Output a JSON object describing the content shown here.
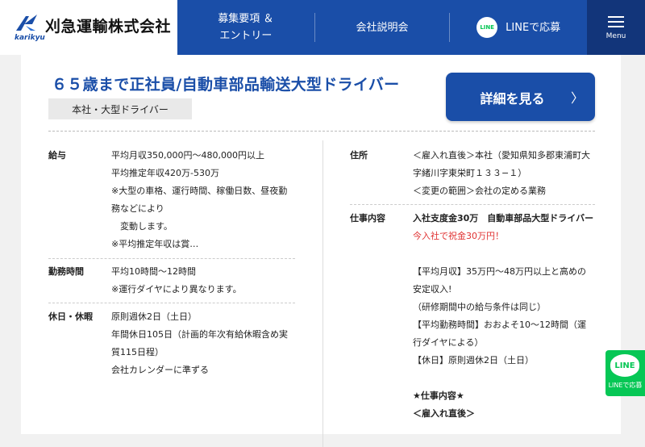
{
  "header": {
    "logo_sub": "karikyu",
    "company_name": "刈急運輸株式会社",
    "nav": {
      "recruit_line1": "募集要項 ＆",
      "recruit_line2": "エントリー",
      "briefing": "会社説明会",
      "line_icon": "LINE",
      "line_apply": "LINEで応募"
    },
    "menu_label": "Menu"
  },
  "job": {
    "title": "６５歳まで正社員/自動車部品輸送大型ドライバー",
    "tag": "本社・大型ドライバー",
    "detail_button": "詳細を見る",
    "detail_chevron": "〉"
  },
  "left": {
    "salary": {
      "label": "給与",
      "lines": [
        "平均月収350,000円〜480,000円以上",
        "平均推定年収420万-530万",
        "※大型の車格、運行時間、稼働日数、昼夜勤",
        "務などにより",
        "　変動します。",
        "※平均推定年収は賞…"
      ]
    },
    "hours": {
      "label": "勤務時間",
      "lines": [
        "平均10時間〜12時間",
        "※運行ダイヤにより異なります。"
      ]
    },
    "holidays": {
      "label": "休日・休暇",
      "lines": [
        "原則週休2日（土日）",
        "年間休日105日（計画的年次有給休暇含め実",
        "質115日程）",
        "会社カレンダーに準ずる"
      ]
    }
  },
  "right": {
    "address": {
      "label": "住所",
      "lines": [
        "＜雇入れ直後＞本社（愛知県知多郡東浦町大",
        "字緒川字東栄町１３３−１）",
        "＜変更の範囲＞会社の定める業務"
      ]
    },
    "job_content": {
      "label": "仕事内容",
      "line1": "入社支度金30万　自動車部品大型ドライバー",
      "line2": "今入社で祝金30万円！",
      "lines": [
        "【平均月収】35万円〜48万円以上と高めの",
        "安定収入!",
        "（研修期間中の給与条件は同じ）",
        "【平均勤務時間】おおよそ10〜12時間（運",
        "行ダイヤによる）",
        "【休日】原則週休2日（土日）"
      ],
      "heading1": "★仕事内容★",
      "heading2": "＜雇入れ直後＞"
    }
  },
  "floating_line": {
    "icon": "LINE",
    "label": "LINEで応募"
  },
  "colors": {
    "brand_blue": "#1a4ea8",
    "menu_navy": "#12357a",
    "line_green": "#06c755",
    "accent_red": "#e03131"
  }
}
